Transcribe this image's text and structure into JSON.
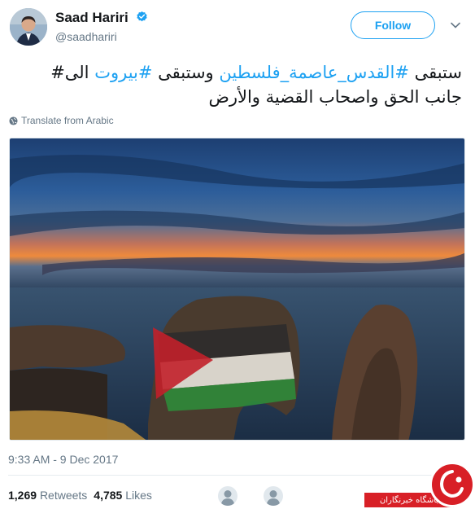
{
  "author": {
    "name": "Saad Hariri",
    "handle": "@saadhariri"
  },
  "follow_label": "Follow",
  "tweet": {
    "seg1": "ستبقى ",
    "tag1": "#القدس_عاصمة_فلسطين",
    "seg2": " وستبقى ",
    "tag2": "#بيروت",
    "seg3": " الى# جانب الحق واصحاب القضية والأرض"
  },
  "translate_label": "Translate from Arabic",
  "timestamp": "9:33 AM - 9 Dec 2017",
  "stats": {
    "retweets_count": "1,269",
    "retweets_label": "Retweets",
    "likes_count": "4,785",
    "likes_label": "Likes"
  },
  "watermark_text": "باشگاه خبرنگاران",
  "colors": {
    "link": "#1da1f2",
    "muted": "#657786",
    "watermark": "#d81f26"
  },
  "icons": {
    "verified": "verified-badge-icon",
    "globe": "globe-icon",
    "chevron": "chevron-down-icon"
  }
}
